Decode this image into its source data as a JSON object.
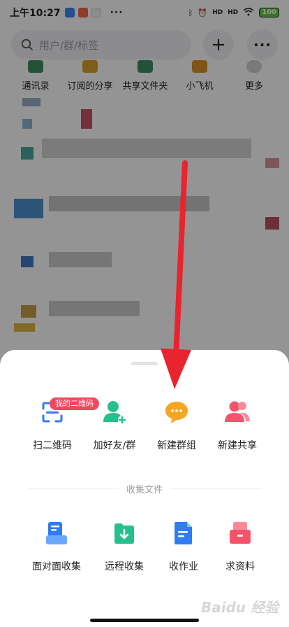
{
  "status_bar": {
    "time": "上午10:27",
    "dots": "···",
    "signal1": "HD",
    "signal2": "HD",
    "battery": "100"
  },
  "search": {
    "placeholder": "用户/群/标签",
    "add_symbol": "+",
    "more_symbol": "···"
  },
  "quick_links": [
    {
      "label": "通讯录",
      "icon": "contacts-icon",
      "color": "#3d8d66"
    },
    {
      "label": "订阅的分享",
      "icon": "bookmark-icon",
      "color": "#d9a126"
    },
    {
      "label": "共享文件夹",
      "icon": "shared-folder-icon",
      "color": "#3d8d66"
    },
    {
      "label": "小飞机",
      "icon": "paper-plane-icon",
      "color": "#d99326"
    },
    {
      "label": "更多",
      "icon": "heart-icon",
      "color": "#b8b8b8"
    }
  ],
  "sheet": {
    "top_actions": [
      {
        "label": "扫二维码",
        "icon": "scan-qr-icon",
        "color": "#2f7cf6"
      },
      {
        "label": "加好友/群",
        "icon": "add-friend-icon",
        "color": "#27c08a"
      },
      {
        "label": "新建群组",
        "icon": "new-group-chat-icon",
        "color": "#f6a623"
      },
      {
        "label": "新建共享",
        "icon": "new-share-icon",
        "color": "#f3546a"
      }
    ],
    "qr_badge": "我的二维码",
    "section_title": "收集文件",
    "collect_actions": [
      {
        "label": "面对面收集",
        "icon": "face-to-face-collect-icon",
        "color": "#2f7cf6"
      },
      {
        "label": "远程收集",
        "icon": "remote-collect-icon",
        "color": "#27c08a"
      },
      {
        "label": "收作业",
        "icon": "homework-icon",
        "color": "#2f7cf6"
      },
      {
        "label": "求资料",
        "icon": "request-materials-icon",
        "color": "#f3546a"
      }
    ]
  },
  "watermark": "Baidu 经验"
}
